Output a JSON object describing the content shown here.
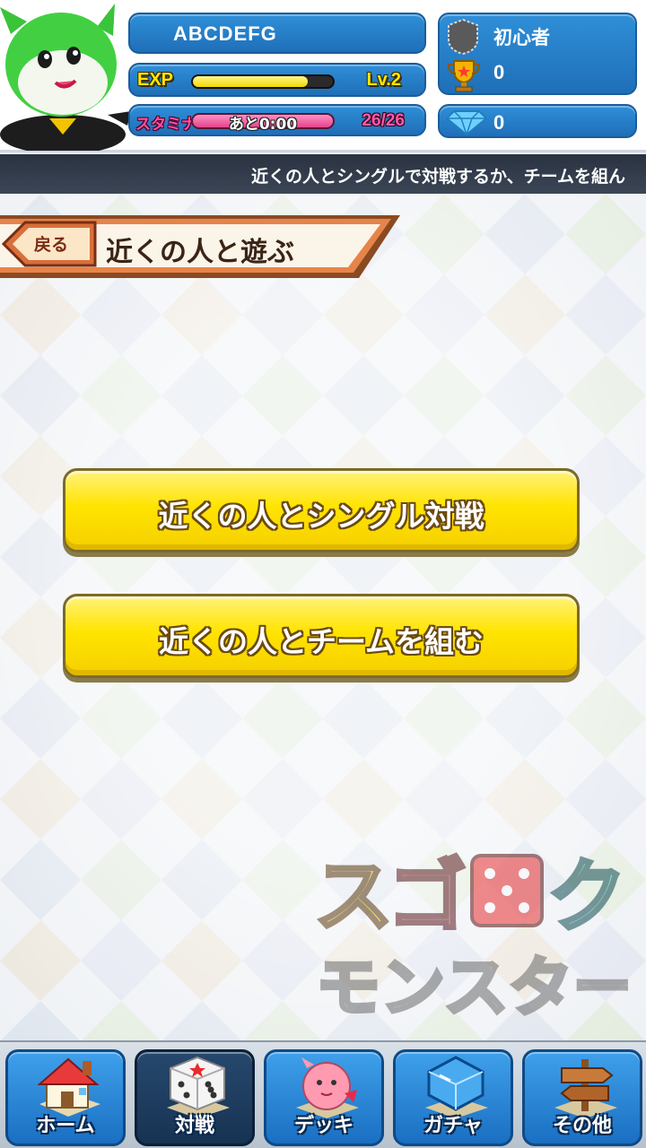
{
  "player": {
    "name": "ABCDEFG",
    "exp_label": "EXP",
    "exp_fraction": 0.82,
    "level_label": "Lv.2",
    "stamina_label": "スタミナ",
    "stamina_time": "あと0:00",
    "stamina_count": "26/26",
    "rank": "初心者",
    "trophies": "0",
    "gems": "0"
  },
  "ticker": {
    "text": "近くの人とシングルで対戦するか、チームを組ん"
  },
  "page": {
    "back_label": "戻る",
    "title": "近くの人と遊ぶ"
  },
  "actions": {
    "single_battle": "近くの人とシングル対戦",
    "team_up": "近くの人とチームを組む"
  },
  "logo": {
    "line1": "スゴロク",
    "line2": "モンスターズ"
  },
  "nav": {
    "items": [
      {
        "label": "ホーム",
        "icon": "house-icon"
      },
      {
        "label": "対戦",
        "icon": "dice-icon"
      },
      {
        "label": "デッキ",
        "icon": "monster-icon"
      },
      {
        "label": "ガチャ",
        "icon": "crystal-icon"
      },
      {
        "label": "その他",
        "icon": "signpost-icon"
      }
    ],
    "active_index": 1
  },
  "colors": {
    "accent_blue": "#1f6fb8",
    "button_yellow": "#ffe400",
    "banner_orange": "#e07a3e"
  }
}
